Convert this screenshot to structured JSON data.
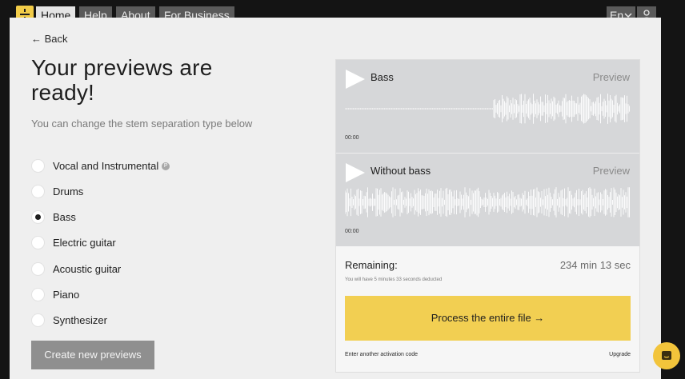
{
  "nav": {
    "items": [
      {
        "label": "Home",
        "active": true
      },
      {
        "label": "Help",
        "active": false
      },
      {
        "label": "About",
        "active": false
      },
      {
        "label": "For Business",
        "active": false
      }
    ],
    "language": "En",
    "icons": {
      "logo": "logo-icon",
      "chevron": "chevron-down-icon",
      "user": "user-icon"
    }
  },
  "back_label": "← Back",
  "heading": "Your previews are ready!",
  "subtitle": "You can change the stem separation type below",
  "options": [
    {
      "label": "Vocal and Instrumental",
      "badge": "P",
      "selected": false
    },
    {
      "label": "Drums",
      "selected": false
    },
    {
      "label": "Bass",
      "selected": true
    },
    {
      "label": "Electric guitar",
      "selected": false
    },
    {
      "label": "Acoustic guitar",
      "selected": false
    },
    {
      "label": "Piano",
      "selected": false
    },
    {
      "label": "Synthesizer",
      "selected": false
    }
  ],
  "create_button": "Create new previews",
  "tracks": [
    {
      "name": "Bass",
      "preview_label": "Preview",
      "time": "00:00"
    },
    {
      "name": "Without bass",
      "preview_label": "Preview",
      "time": "00:00"
    }
  ],
  "remaining": {
    "label": "Remaining:",
    "value": "234 min 13 sec",
    "note": "You will have 5 minutes 33 seconds deducted"
  },
  "process_button": "Process the entire file →",
  "activation_link": "Enter another activation code",
  "upgrade_link": "Upgrade",
  "colors": {
    "accent": "#f2cf52",
    "track_bg": "#d6d7d9",
    "page_bg": "#efefef",
    "topbar": "#141414"
  }
}
